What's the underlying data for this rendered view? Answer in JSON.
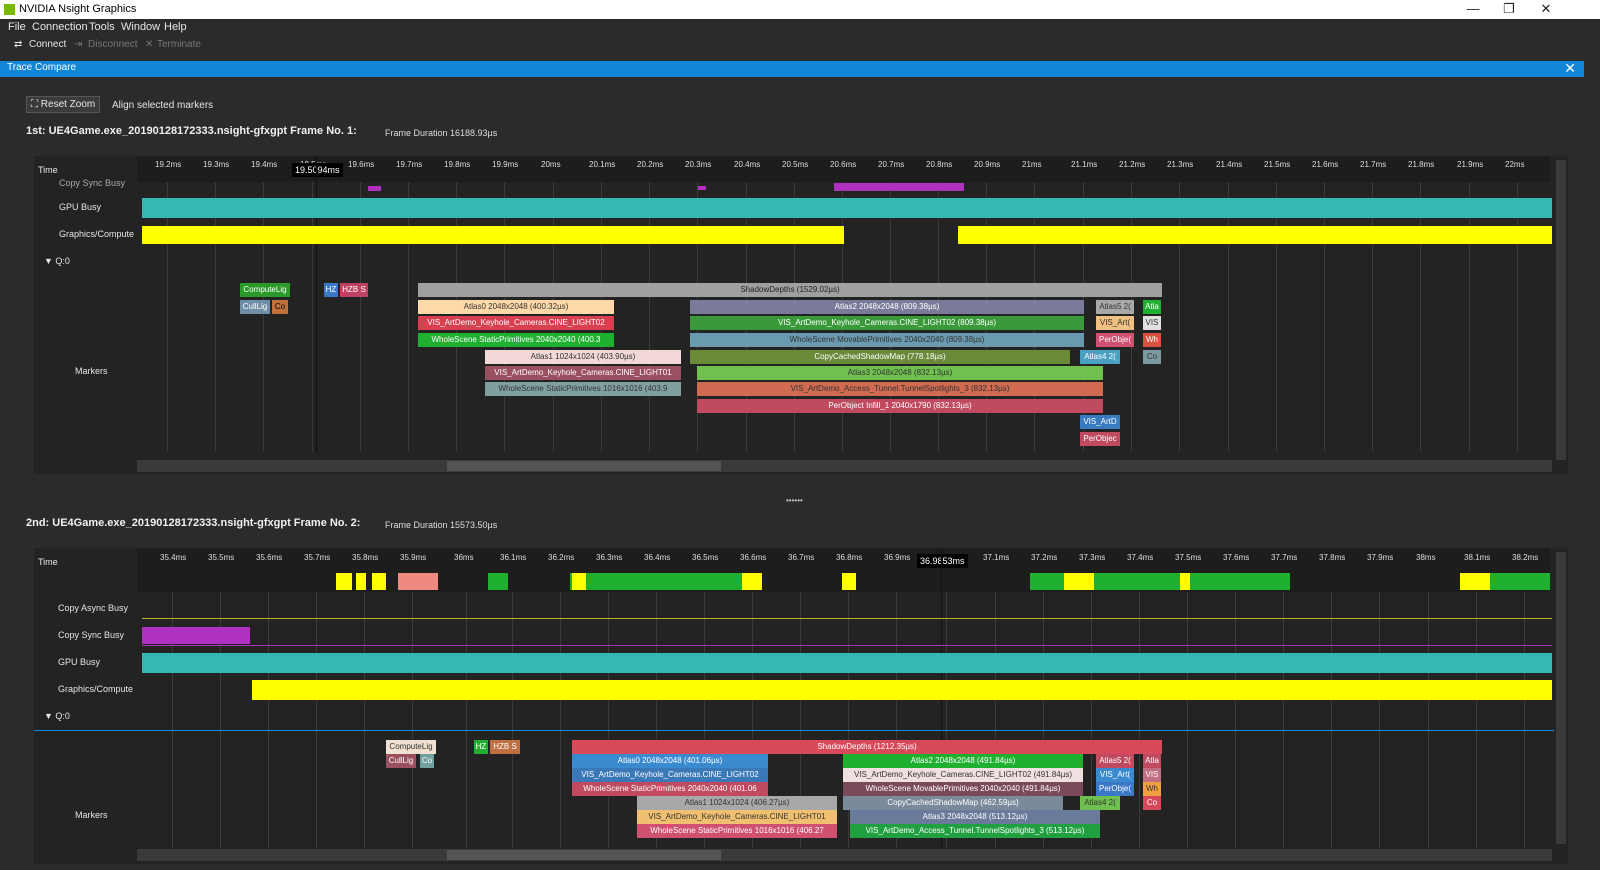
{
  "app": {
    "title": "NVIDIA Nsight Graphics",
    "min": "—",
    "max": "❐",
    "close": "✕"
  },
  "menu": [
    "File",
    "Connection",
    "Tools",
    "Window",
    "Help"
  ],
  "toolbar": {
    "connect": "Connect",
    "disconnect": "Disconnect",
    "terminate": "Terminate"
  },
  "tab": {
    "label": "Trace Compare",
    "close": "✕"
  },
  "controls": {
    "reset_zoom": "Reset Zoom",
    "align_markers": "Align selected markers"
  },
  "trace1": {
    "header": "1st: UE4Game.exe_20190128172333.nsight-gfxgpt  Frame No. 1:",
    "duration": "Frame Duration 16188.93µs",
    "cursor": "19.5094ms",
    "ticks": [
      "19.2ms",
      "19.3ms",
      "19.4ms",
      "19.5ms",
      "19.6ms",
      "19.7ms",
      "19.8ms",
      "19.9ms",
      "20ms",
      "20.1ms",
      "20.2ms",
      "20.3ms",
      "20.4ms",
      "20.5ms",
      "20.6ms",
      "20.7ms",
      "20.8ms",
      "20.9ms",
      "21ms",
      "21.1ms",
      "21.2ms",
      "21.3ms",
      "21.4ms",
      "21.5ms",
      "21.6ms",
      "21.7ms",
      "21.8ms",
      "21.9ms",
      "22ms"
    ],
    "rows": {
      "time": "Time",
      "copy": "Copy Sync Busy",
      "gpu": "GPU Busy",
      "gfx": "Graphics/Compute",
      "queue": "Q:0",
      "markers": "Markers"
    },
    "bars": [
      {
        "label": "ComputeLig",
        "color": "#2a9a2a"
      },
      {
        "label": "CullLig",
        "color": "#6f8fa8"
      },
      {
        "label": "Co",
        "color": "#c0703a"
      },
      {
        "label": "HZ",
        "color": "#3a78c8"
      },
      {
        "label": "HZB S",
        "color": "#c04060"
      },
      {
        "label": "ShadowDepths (1529.02µs)",
        "color": "#a0a0a0"
      },
      {
        "label": "Atlas0 2048x2048 (400.32µs)",
        "color": "#ffd9a8"
      },
      {
        "label": "VIS_ArtDemo_Keyhole_Cameras.CINE_LIGHT02",
        "color": "#d84050"
      },
      {
        "label": "WholeScene StaticPrimitives 2040x2040 (400.3",
        "color": "#20b030"
      },
      {
        "label": "Atlas1 1024x1024 (403.90µs)",
        "color": "#f3d8d8"
      },
      {
        "label": "VIS_ArtDemo_Keyhole_Cameras.CINE_LIGHT01",
        "color": "#9a5060"
      },
      {
        "label": "WholeScene StaticPrimitives 1016x1016 (403.9",
        "color": "#80a0a0"
      },
      {
        "label": "Atlas2 2048x2048 (809.38µs)",
        "color": "#7a7a9a"
      },
      {
        "label": "VIS_ArtDemo_Keyhole_Cameras.CINE_LIGHT02 (809.38µs)",
        "color": "#3a9a3a"
      },
      {
        "label": "WholeScene MovablePrimitives 2040x2040 (809.38µs)",
        "color": "#6a9ab0"
      },
      {
        "label": "CopyCachedShadowMap (778.18µs)",
        "color": "#6a8a3a"
      },
      {
        "label": "Atlas3 2048x2048 (832.13µs)",
        "color": "#70c050"
      },
      {
        "label": "VIS_ArtDemo_Access_Tunnel.TunnelSpotlights_3 (832.13µs)",
        "color": "#d06a50"
      },
      {
        "label": "PerObject Infill_1 2040x1790 (832.13µs)",
        "color": "#c04a60"
      },
      {
        "label": "Atlas5 2(",
        "color": "#a8a8a8"
      },
      {
        "label": "VIS_Art(",
        "color": "#f0c080"
      },
      {
        "label": "PerObje(",
        "color": "#d05070"
      },
      {
        "label": "Atlas4 2(",
        "color": "#4aa0c0"
      },
      {
        "label": "VIS_ArtD",
        "color": "#3a7ac0"
      },
      {
        "label": "PerObjec",
        "color": "#c04a60"
      },
      {
        "label": "Atla",
        "color": "#20b030"
      },
      {
        "label": "VIS",
        "color": "#e0e0e0"
      },
      {
        "label": "Wh",
        "color": "#d85040"
      },
      {
        "label": "Co",
        "color": "#7a9aa0"
      }
    ]
  },
  "trace2": {
    "header": "2nd: UE4Game.exe_20190128172333.nsight-gfxgpt  Frame No. 2:",
    "duration": "Frame Duration 15573.50µs",
    "cursor": "36.9853ms",
    "ticks": [
      "35.4ms",
      "35.5ms",
      "35.6ms",
      "35.7ms",
      "35.8ms",
      "35.9ms",
      "36ms",
      "36.1ms",
      "36.2ms",
      "36.3ms",
      "36.4ms",
      "36.5ms",
      "36.6ms",
      "36.7ms",
      "36.8ms",
      "36.9ms",
      "37ms",
      "37.1ms",
      "37.2ms",
      "37.3ms",
      "37.4ms",
      "37.5ms",
      "37.6ms",
      "37.7ms",
      "37.8ms",
      "37.9ms",
      "38ms",
      "38.1ms",
      "38.2ms"
    ],
    "rows": {
      "time": "Time",
      "async": "Copy Async Busy",
      "copy": "Copy Sync Busy",
      "gpu": "GPU Busy",
      "gfx": "Graphics/Compute",
      "queue": "Q:0",
      "markers": "Markers"
    },
    "bars": [
      {
        "label": "ComputeLig",
        "color": "#f0e0d0"
      },
      {
        "label": "CullLig",
        "color": "#9a5060"
      },
      {
        "label": "Co",
        "color": "#70a0a0"
      },
      {
        "label": "HZ",
        "color": "#20b030"
      },
      {
        "label": "HZB S",
        "color": "#c07040"
      },
      {
        "label": "ShadowDepths (1212.35µs)",
        "color": "#d84a5a"
      },
      {
        "label": "Atlas0 2048x2048 (401.06µs)",
        "color": "#3a8ad0"
      },
      {
        "label": "VIS_ArtDemo_Keyhole_Cameras.CINE_LIGHT02",
        "color": "#3a78b8"
      },
      {
        "label": "WholeScene StaticPrimitives 2040x2040 (401.06",
        "color": "#c04a60"
      },
      {
        "label": "Atlas1 1024x1024 (406.27µs)",
        "color": "#a8a8a8"
      },
      {
        "label": "VIS_ArtDemo_Keyhole_Cameras.CINE_LIGHT01",
        "color": "#f0c070"
      },
      {
        "label": "WholeScene StaticPrimitives 1016x1016 (406.27",
        "color": "#d05070"
      },
      {
        "label": "Atlas2 2048x2048 (491.84µs)",
        "color": "#20b030"
      },
      {
        "label": "VIS_ArtDemo_Keyhole_Cameras.CINE_LIGHT02 (491.84µs)",
        "color": "#f0e0e0"
      },
      {
        "label": "WholeScene MovablePrimitives 2040x2040 (491.84µs)",
        "color": "#7a4a5a"
      },
      {
        "label": "CopyCachedShadowMap (462.59µs)",
        "color": "#7a8a9a"
      },
      {
        "label": "Atlas3 2048x2048 (513.12µs)",
        "color": "#6a7a9a"
      },
      {
        "label": "VIS_ArtDemo_Access_Tunnel.TunnelSpotlights_3 (513.12µs)",
        "color": "#20a040"
      },
      {
        "label": "Atlas5 2(",
        "color": "#c04a60"
      },
      {
        "label": "VIS_Art(",
        "color": "#3a8ad0"
      },
      {
        "label": "PerObje(",
        "color": "#3a78c8"
      },
      {
        "label": "Atlas4 2(",
        "color": "#70c050"
      },
      {
        "label": "Atla",
        "color": "#c04a60"
      },
      {
        "label": "VIS",
        "color": "#c07080"
      },
      {
        "label": "Wh",
        "color": "#f0a040"
      },
      {
        "label": "Co",
        "color": "#d84a5a"
      }
    ]
  },
  "splitter": "••••••",
  "colors": {
    "gpu": "#35b7b3",
    "gfx": "#ffff00",
    "copy": "#b030c0",
    "accent": "#1185d6"
  }
}
